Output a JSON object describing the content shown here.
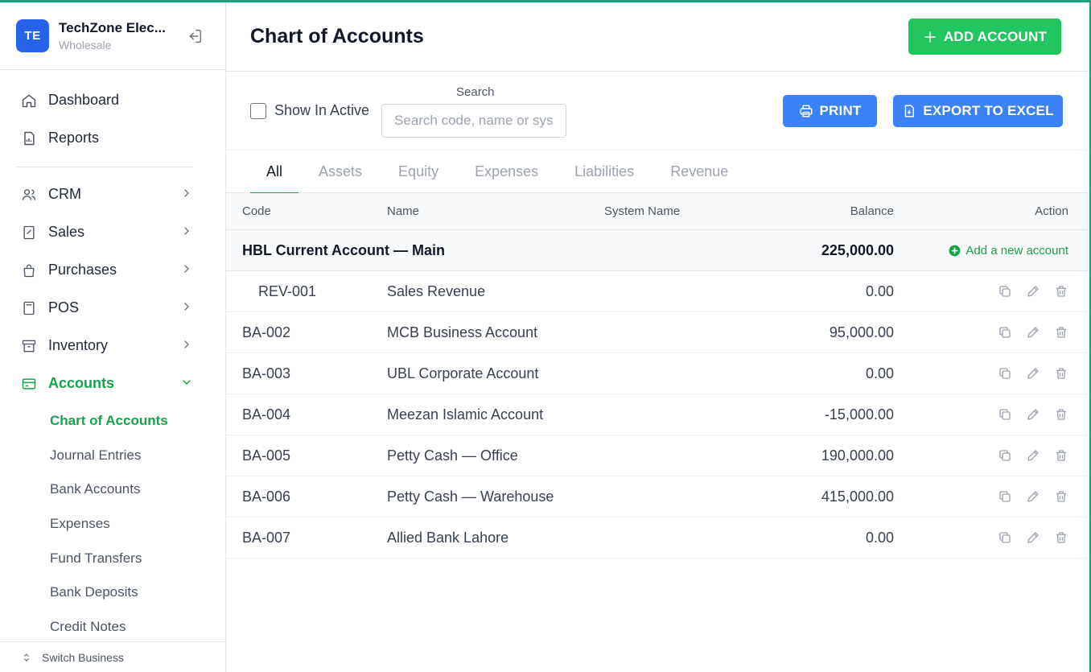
{
  "business": {
    "initials": "TE",
    "name": "TechZone Elec...",
    "type": "Wholesale"
  },
  "sidebar": {
    "items": [
      {
        "label": "Dashboard",
        "icon": "home-icon"
      },
      {
        "label": "Reports",
        "icon": "report-icon"
      },
      {
        "label": "CRM",
        "icon": "users-icon"
      },
      {
        "label": "Sales",
        "icon": "receipt-icon"
      },
      {
        "label": "Purchases",
        "icon": "bag-icon"
      },
      {
        "label": "POS",
        "icon": "calculator-icon"
      },
      {
        "label": "Inventory",
        "icon": "archive-icon"
      },
      {
        "label": "Accounts",
        "icon": "card-icon"
      }
    ],
    "subitems": [
      "Chart of Accounts",
      "Journal Entries",
      "Bank Accounts",
      "Expenses",
      "Fund Transfers",
      "Bank Deposits",
      "Credit Notes"
    ],
    "switch_label": "Switch Business"
  },
  "header": {
    "title": "Chart of Accounts",
    "add_label": "ADD ACCOUNT"
  },
  "toolbar": {
    "show_inactive": "Show In Active",
    "search_label": "Search",
    "search_placeholder": "Search code, name or system name",
    "print_label": "PRINT",
    "export_label": "EXPORT TO EXCEL"
  },
  "tabs": [
    "All",
    "Assets",
    "Equity",
    "Expenses",
    "Liabilities",
    "Revenue"
  ],
  "table": {
    "columns": {
      "code": "Code",
      "name": "Name",
      "system": "System Name",
      "balance": "Balance",
      "action": "Action"
    },
    "group": {
      "name": "HBL Current Account — Main",
      "balance": "225,000.00",
      "add_label": "Add a new account"
    },
    "rows": [
      {
        "code": "REV-001",
        "name": "Sales Revenue",
        "system": "",
        "balance": "0.00"
      },
      {
        "code": "BA-002",
        "name": "MCB Business Account",
        "system": "",
        "balance": "95,000.00"
      },
      {
        "code": "BA-003",
        "name": "UBL Corporate Account",
        "system": "",
        "balance": "0.00"
      },
      {
        "code": "BA-004",
        "name": "Meezan Islamic Account",
        "system": "",
        "balance": "-15,000.00"
      },
      {
        "code": "BA-005",
        "name": "Petty Cash — Office",
        "system": "",
        "balance": "190,000.00"
      },
      {
        "code": "BA-006",
        "name": "Petty Cash — Warehouse",
        "system": "",
        "balance": "415,000.00"
      },
      {
        "code": "BA-007",
        "name": "Allied Bank Lahore",
        "system": "",
        "balance": "0.00"
      }
    ]
  },
  "colors": {
    "accent_green": "#16a34a",
    "button_green": "#22c55e",
    "button_blue": "#3b82f6",
    "logo_blue": "#2563eb"
  }
}
